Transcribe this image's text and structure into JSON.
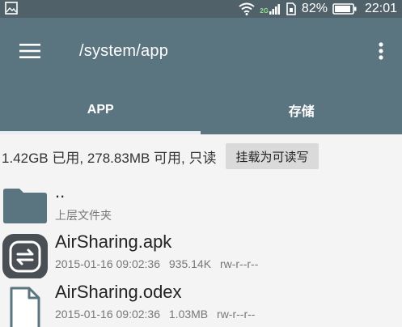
{
  "status_bar": {
    "network_type": "2G",
    "battery_percent": "82%",
    "time": "22:01"
  },
  "app_bar": {
    "path": "/system/app",
    "tabs": [
      {
        "label": "APP",
        "active": true
      },
      {
        "label": "存储",
        "active": false
      }
    ]
  },
  "storage": {
    "summary": "1.42GB 已用, 278.83MB 可用, 只读",
    "mount_button_label": "挂载为可读写"
  },
  "files": [
    {
      "name": "..",
      "subtitle": "上层文件夹",
      "icon": "folder-icon"
    },
    {
      "name": "AirSharing.apk",
      "date": "2015-01-16 09:02:36",
      "size": "935.14K",
      "permissions": "rw-r--r--",
      "icon": "airsharing-app-icon"
    },
    {
      "name": "AirSharing.odex",
      "date": "2015-01-16 09:02:36",
      "size": "1.03MB",
      "permissions": "rw-r--r--",
      "icon": "file-icon"
    }
  ],
  "colors": {
    "status_bar": "#50616a",
    "app_bar": "#5b7580",
    "folder": "#5b7580",
    "background": "#f4f4f4"
  }
}
